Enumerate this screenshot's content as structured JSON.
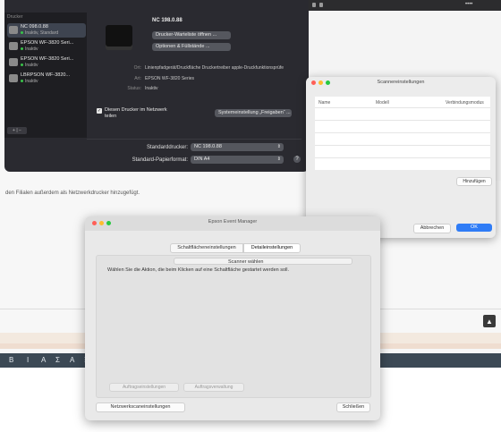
{
  "background": {
    "caption": "den Filialen außerdem als Netzwerkdrucker hinzugefügt.",
    "editor_tools": [
      "B",
      "I",
      "A",
      "Σ",
      "A",
      "☰",
      "✎"
    ],
    "topbar_text": "••••"
  },
  "printers_window": {
    "sidebar_header": "Drucker",
    "printers": [
      {
        "name": "NC 098.0.88",
        "status": "Inaktiv, Standard"
      },
      {
        "name": "EPSON WF-3820 Seri...",
        "status": "Inaktiv"
      },
      {
        "name": "EPSON WF-3820 Seri...",
        "status": "Inaktiv"
      },
      {
        "name": "LBRPSON WF-3820...",
        "status": "Inaktiv"
      }
    ],
    "add_remove": "+ | −",
    "selected_title": "NC 198.0.88",
    "queue_button": "Drucker-Warteliste öffnen ...",
    "options_button": "Optionen & Füllstände ...",
    "info": [
      {
        "label": "Ort:",
        "value": "Linienpfadgerät/Druckfläche Druckertreiber apple-Druckfunktionsprüfe"
      },
      {
        "label": "Art:",
        "value": "EPSON WF-3820 Series"
      },
      {
        "label": "Status:",
        "value": "Inaktiv"
      }
    ],
    "share_checked": true,
    "share_label": "Diesen Drucker im Netzwerk teilen",
    "share_settings_button": "Systemeinstellung „Freigaben“ ...",
    "default_printer_label": "Standarddrucker:",
    "default_printer_value": "NC 198.0.88",
    "default_paper_label": "Standard-Papierformat:",
    "default_paper_value": "DIN A4",
    "help": "?"
  },
  "scanner_dialog": {
    "title": "Scannereinstellungen",
    "columns": [
      "Name",
      "Modell",
      "Verbindungsmodus"
    ],
    "add_button": "Hinzufügen",
    "help": "?",
    "cancel": "Abbrechen",
    "ok": "OK"
  },
  "epson_dialog": {
    "title": "Epson Event Manager",
    "tab_buttons": "Schaltflächeneinstellungen",
    "tab_detail": "Detaileinstellungen",
    "scanner_select": "Scanner wählen",
    "description": "Wählen Sie die Aktion, die beim Klicken auf eine Schaltfläche gestartet werden soll.",
    "action_button_1": "Auftragseinstellungen",
    "action_button_2": "Auftragsverwaltung",
    "network_button": "Netzwerkscaneinstellungen",
    "close_button": "Schließen"
  },
  "colors": {
    "traffic_red": "#ff5f57",
    "traffic_yellow": "#febc2e",
    "traffic_green": "#28c840",
    "accent_blue": "#2f7cf6"
  }
}
